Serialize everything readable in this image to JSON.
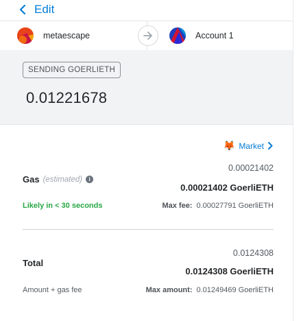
{
  "header": {
    "back_label": "Edit"
  },
  "accounts": {
    "from_name": "metaescape",
    "to_name": "Account 1"
  },
  "summary": {
    "badge": "SENDING GOERLIETH",
    "amount": "0.01221678"
  },
  "details": {
    "market_label": "Market",
    "gas": {
      "label": "Gas",
      "estimated_label": "(estimated)",
      "value": "0.00021402",
      "value_bold": "0.00021402 GoerliETH",
      "likely": "Likely in < 30 seconds",
      "max_fee_key": "Max fee:",
      "max_fee_value": "0.00027791 GoerliETH"
    },
    "total": {
      "label": "Total",
      "value": "0.0124308",
      "value_bold": "0.0124308 GoerliETH",
      "sub_label": "Amount + gas fee",
      "max_amount_key": "Max amount:",
      "max_amount_value": "0.01249469 GoerliETH"
    }
  },
  "colors": {
    "link": "#037dd6",
    "success": "#28a745",
    "summary_bg": "#f2f3f4"
  },
  "icons": {
    "back": "chevron-left-icon",
    "transfer": "arrow-right-icon",
    "info": "info-icon",
    "market": "fox-icon",
    "market_chevron": "chevron-right-icon"
  }
}
